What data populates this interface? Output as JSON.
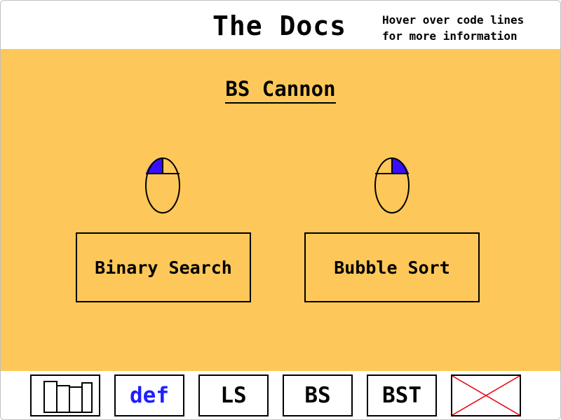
{
  "header": {
    "title": "The Docs",
    "hint_line1": "Hover over code lines",
    "hint_line2": "for more information"
  },
  "main": {
    "page_title": "BS Cannon",
    "left_button": {
      "label": "Binary Search",
      "mouse_icon": "left-click-mouse-icon"
    },
    "right_button": {
      "label": "Bubble Sort",
      "mouse_icon": "right-click-mouse-icon"
    }
  },
  "toolbar": {
    "items": [
      {
        "icon": "bar-chart-icon"
      },
      {
        "label": "def"
      },
      {
        "label": "LS"
      },
      {
        "label": "BS"
      },
      {
        "label": "BST"
      },
      {
        "icon": "close-x-icon"
      }
    ]
  },
  "colors": {
    "background_main": "#fdc859",
    "mouse_highlight": "#3a0fff",
    "def_text": "#1f1fff",
    "close_x": "#e8000b",
    "border": "#000000"
  }
}
